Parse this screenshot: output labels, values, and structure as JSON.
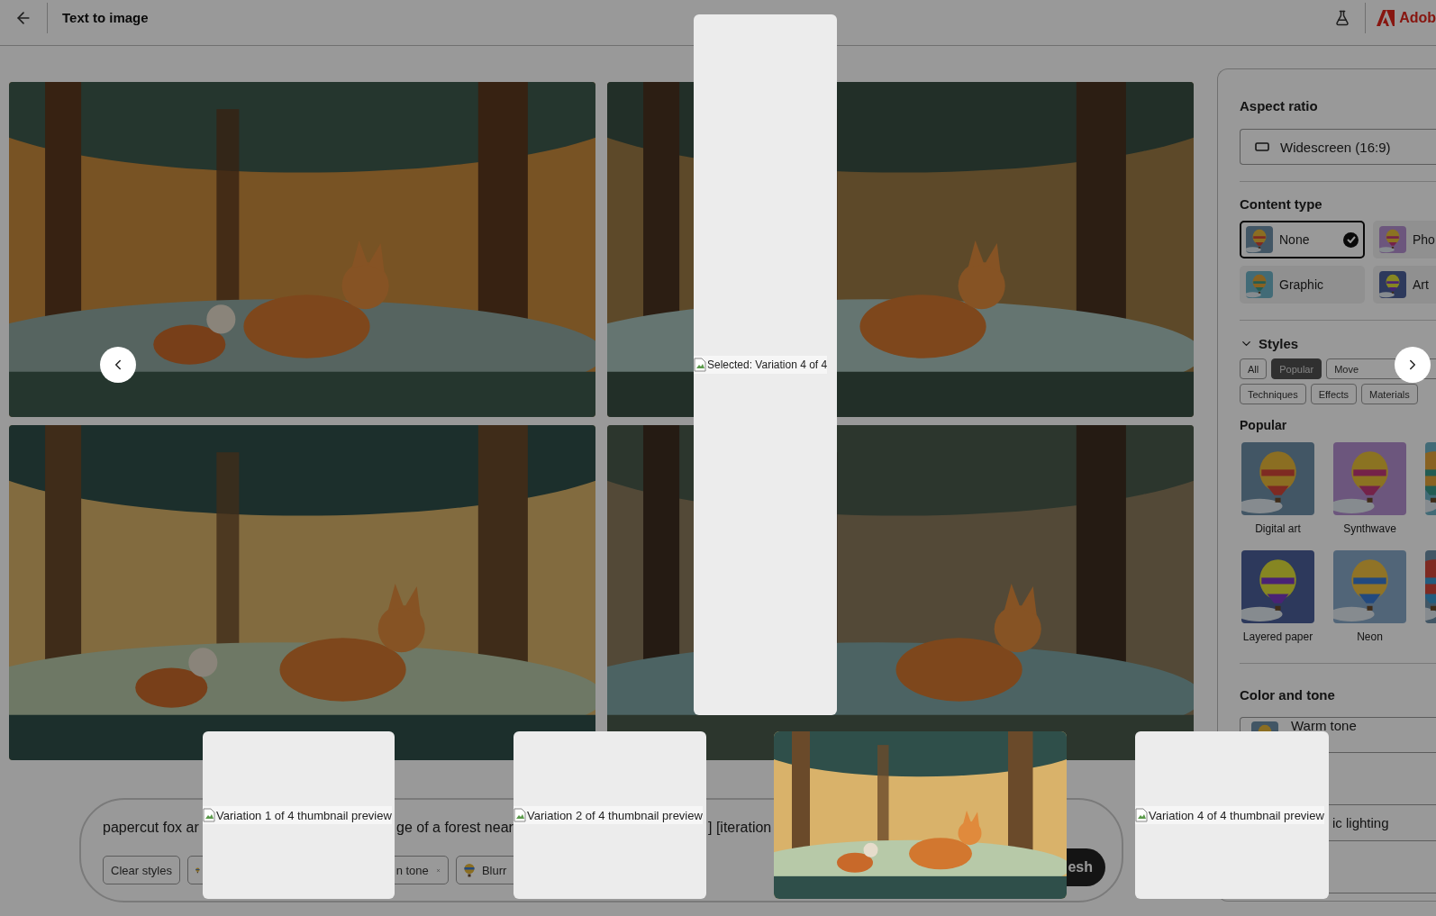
{
  "top_bar": {
    "title": "Text to image",
    "brand": "Adob"
  },
  "gallery": {
    "images": [
      {
        "kind": "picture"
      },
      {
        "kind": "picture"
      },
      {
        "kind": "picture"
      },
      {
        "kind": "picture"
      }
    ]
  },
  "prompt": {
    "text_fragments": [
      "papercut fox ar",
      "ge of a forest near",
      "] [iteration"
    ],
    "chips": [
      {
        "kind": "clear",
        "label": "Clear styles"
      },
      {
        "kind": "style",
        "label": "n tone",
        "removable": true
      },
      {
        "kind": "style",
        "label": "Blurr"
      }
    ],
    "generate_button": "esh"
  },
  "panel": {
    "aspect_ratio": {
      "label": "Aspect ratio",
      "value": "Widescreen (16:9)"
    },
    "content_type": {
      "label": "Content type",
      "options": [
        {
          "label": "None",
          "selected": true
        },
        {
          "label": "Pho",
          "selected": false
        },
        {
          "label": "Graphic",
          "selected": false
        },
        {
          "label": "Art",
          "selected": false
        }
      ]
    },
    "styles": {
      "label": "Styles",
      "expanded": true,
      "tabs": [
        {
          "label": "All",
          "selected": false
        },
        {
          "label": "Popular",
          "selected": true
        },
        {
          "label": "Move",
          "selected": false
        },
        {
          "label": "Techniques",
          "selected": false
        },
        {
          "label": "Effects",
          "selected": false
        },
        {
          "label": "Materials",
          "selected": false
        }
      ],
      "section": "Popular",
      "items": [
        {
          "label": "Digital art"
        },
        {
          "label": "Synthwave"
        },
        {
          "kind": "picture"
        },
        {
          "label": "Layered paper"
        },
        {
          "label": "Neon"
        },
        {
          "kind": "picture"
        }
      ]
    },
    "color_tone": {
      "label": "Color and tone",
      "fields": [
        {
          "kind": "tone",
          "label": "Warm tone"
        },
        {
          "kind": "blank"
        },
        {
          "kind": "clipped",
          "label": "ic lighting"
        },
        {
          "kind": "blank"
        }
      ]
    }
  },
  "overlays": {
    "selected_preview": "Selected: Variation 4 of 4",
    "thumbnails": [
      {
        "kind": "broken",
        "alt": "Variation 1 of 4 thumbnail preview"
      },
      {
        "kind": "broken",
        "alt": "Variation 2 of 4 thumbnail preview"
      },
      {
        "kind": "picture"
      },
      {
        "kind": "broken",
        "alt": "Variation 4 of 4 thumbnail preview"
      }
    ]
  }
}
